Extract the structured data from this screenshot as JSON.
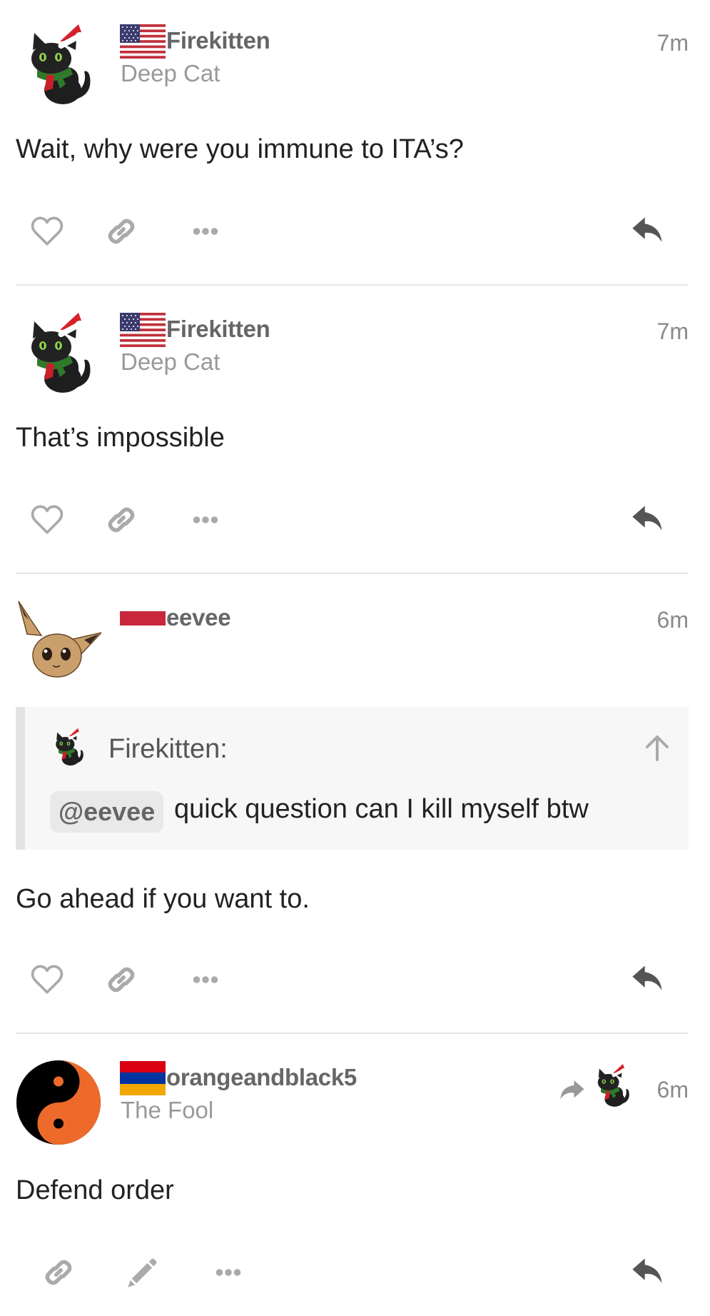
{
  "posts": [
    {
      "username": "Firekitten",
      "user_title": "Deep Cat",
      "time": "7m",
      "body": "Wait, why were you immune to ITA’s?",
      "flag": "us-flag"
    },
    {
      "username": "Firekitten",
      "user_title": "Deep Cat",
      "time": "7m",
      "body": "That’s impossible",
      "flag": "us-flag"
    },
    {
      "username": "eevee",
      "user_title": "",
      "time": "6m",
      "body": "Go ahead if you want to.",
      "flag": "red-flag",
      "quote": {
        "author": "Firekitten:",
        "mention": "@eevee",
        "text": "quick question can I kill myself btw"
      }
    },
    {
      "username": "orangeandblack5",
      "user_title": "The Fool",
      "time": "6m",
      "body": "Defend order",
      "flag": "armenia-flag"
    }
  ],
  "icons": {
    "like": "heart-icon",
    "link": "link-icon",
    "more": "ellipsis-icon",
    "reply": "reply-icon",
    "edit": "pencil-icon",
    "reply_to": "reply-arrow-icon",
    "quote_expand": "arrow-up-icon"
  },
  "colors": {
    "icon_gray": "#aaaaaa",
    "reply_dark": "#555555",
    "mention_bg": "#e9e9e9",
    "quote_bg": "#f7f7f7",
    "armenia_red": "#d90012",
    "armenia_blue": "#0033a0",
    "armenia_orange": "#f2a800",
    "yin_orange": "#ee6a2a"
  }
}
